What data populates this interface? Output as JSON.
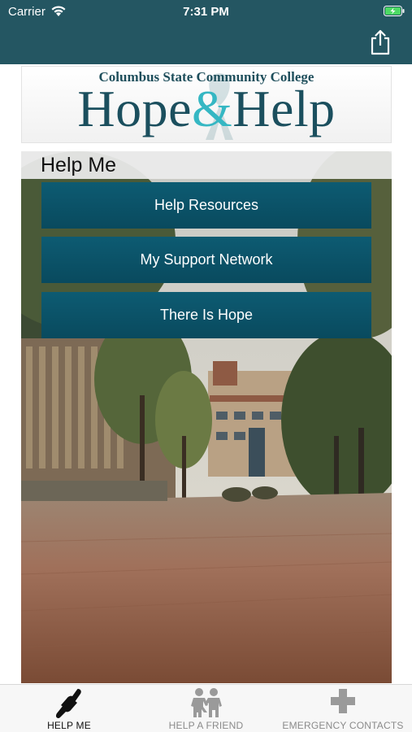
{
  "status_bar": {
    "carrier": "Carrier",
    "time": "7:31 PM",
    "icons": [
      "wifi-icon",
      "battery-charging-icon"
    ]
  },
  "nav_bar": {
    "action_icon": "share-icon",
    "color": "#245662"
  },
  "header": {
    "college": "Columbus State Community College",
    "brand_part1": "Hope",
    "brand_amp": "&",
    "brand_part2": "Help",
    "brand_color": "#1b4f5e",
    "accent_color": "#35b7c3"
  },
  "main": {
    "heading": "Help Me",
    "buttons": [
      {
        "label": "Help Resources"
      },
      {
        "label": "My Support Network"
      },
      {
        "label": "There Is Hope"
      }
    ],
    "button_color": "#0b5369"
  },
  "tab_bar": {
    "tabs": [
      {
        "label": "HELP ME",
        "icon": "helping-hands-icon",
        "active": true
      },
      {
        "label": "HELP A FRIEND",
        "icon": "two-kids-icon",
        "active": false
      },
      {
        "label": "EMERGENCY CONTACTS",
        "icon": "medical-cross-icon",
        "active": false
      }
    ]
  }
}
